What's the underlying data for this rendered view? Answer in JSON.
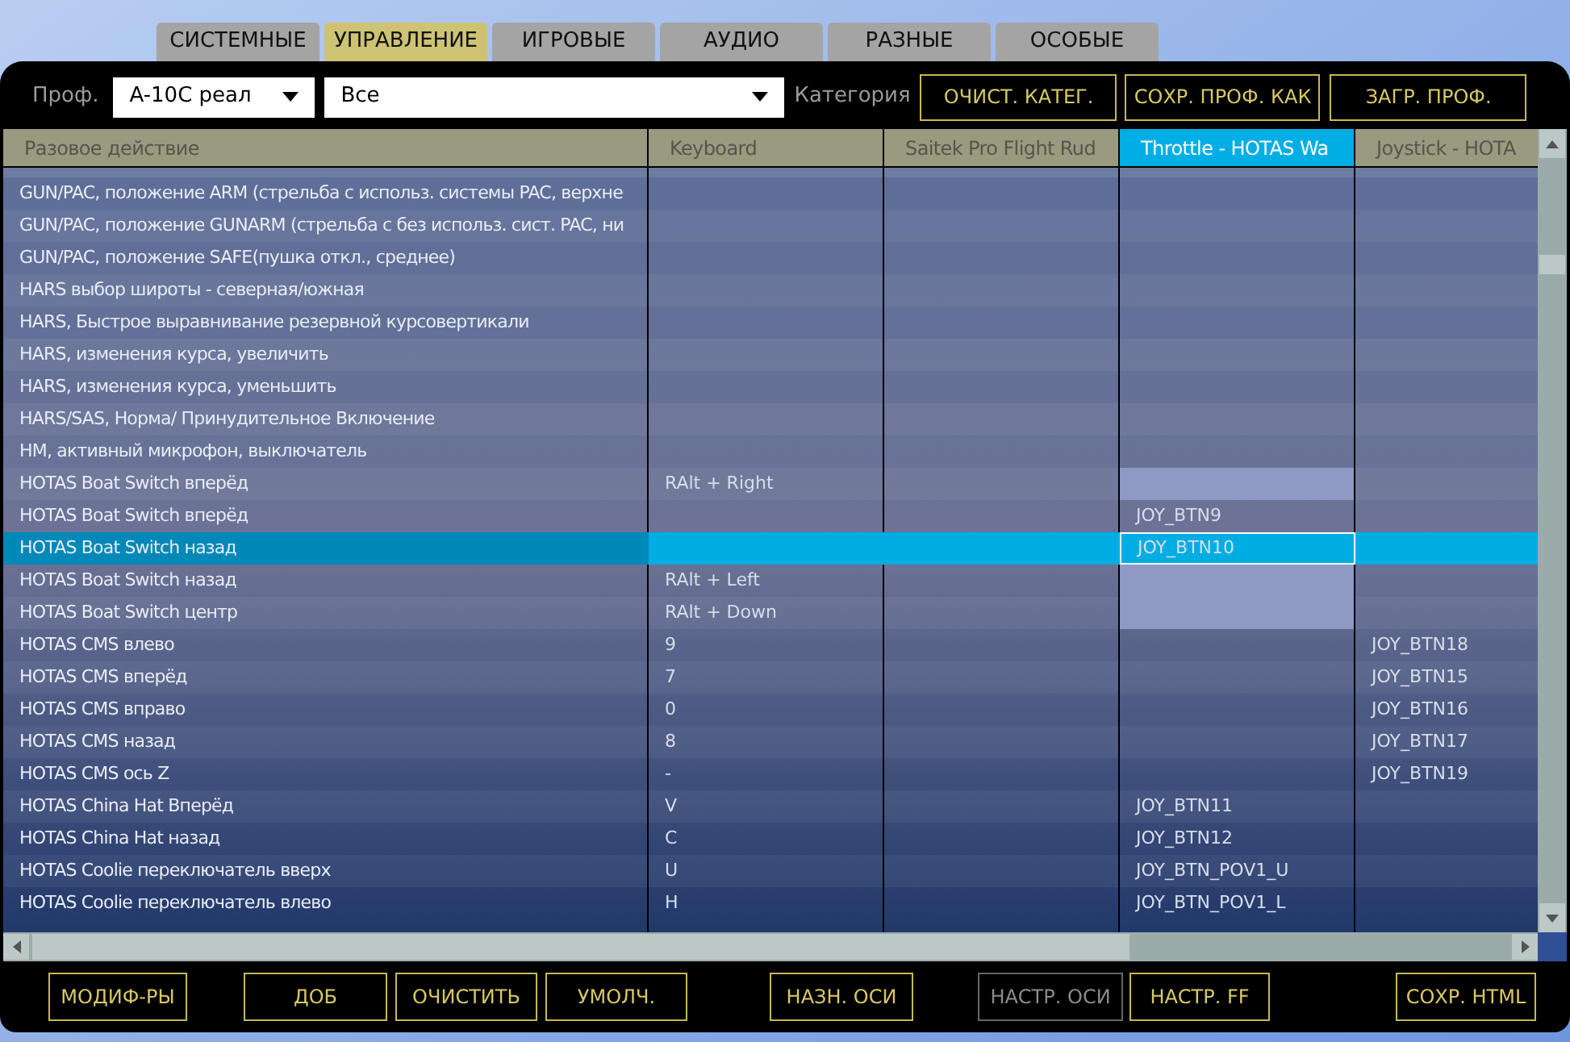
{
  "tabs": [
    {
      "label": "СИСТЕМНЫЕ",
      "selected": false
    },
    {
      "label": "УПРАВЛЕНИЕ",
      "selected": true
    },
    {
      "label": "ИГРОВЫЕ",
      "selected": false
    },
    {
      "label": "АУДИО",
      "selected": false
    },
    {
      "label": "РАЗНЫЕ",
      "selected": false
    },
    {
      "label": "ОСОБЫЕ",
      "selected": false
    }
  ],
  "toolbar": {
    "profile_label": "Проф.",
    "profile": "A-10C реал",
    "filter": "Все",
    "category_label": "Категория",
    "buttons": [
      "ОЧИСТ. КАТЕГ.",
      "СОХР. ПРОФ. КАК",
      "ЗАГР. ПРОФ."
    ]
  },
  "table": {
    "columns": [
      {
        "label": "Разовое действие",
        "selected": false
      },
      {
        "label": "Keyboard",
        "selected": false
      },
      {
        "label": "Saitek Pro Flight Rud",
        "selected": false
      },
      {
        "label": "Throttle - HOTAS Wa",
        "selected": true
      },
      {
        "label": "Joystick - HOTA",
        "selected": false
      }
    ],
    "rows": [
      {
        "cells": [
          "GUN/PAC, положение ARM (стрельба с использ. системы PAC, верхне",
          null,
          null,
          null,
          null
        ],
        "selected": false,
        "marked": false
      },
      {
        "cells": [
          "GUN/PAC, положение GUNARM (стрельба с без использ. сист. PAC, ни",
          null,
          null,
          null,
          null
        ],
        "selected": false,
        "marked": false
      },
      {
        "cells": [
          "GUN/PAC, положение SAFE(пушка откл., среднее)",
          null,
          null,
          null,
          null
        ],
        "selected": false,
        "marked": false
      },
      {
        "cells": [
          "HARS выбор широты - северная/южная",
          null,
          null,
          null,
          null
        ],
        "selected": false,
        "marked": false
      },
      {
        "cells": [
          "HARS, Быстрое выравнивание резервной курсовертикали",
          null,
          null,
          null,
          null
        ],
        "selected": false,
        "marked": false
      },
      {
        "cells": [
          "HARS, изменения курса, увеличить",
          null,
          null,
          null,
          null
        ],
        "selected": false,
        "marked": false
      },
      {
        "cells": [
          "HARS, изменения курса, уменьшить",
          null,
          null,
          null,
          null
        ],
        "selected": false,
        "marked": false
      },
      {
        "cells": [
          "HARS/SAS, Норма/ Принудительное Включение",
          null,
          null,
          null,
          null
        ],
        "selected": false,
        "marked": false
      },
      {
        "cells": [
          "HM, активный микрофон, выключатель",
          null,
          null,
          null,
          null
        ],
        "selected": false,
        "marked": false
      },
      {
        "cells": [
          "HOTAS Boat Switch вперёд",
          "RAlt + Right",
          null,
          null,
          null
        ],
        "selected": false,
        "marked": true
      },
      {
        "cells": [
          "HOTAS Boat Switch вперёд",
          null,
          null,
          "JOY_BTN9",
          null
        ],
        "selected": false,
        "marked": false
      },
      {
        "cells": [
          "HOTAS Boat Switch назад",
          null,
          null,
          "JOY_BTN10",
          null
        ],
        "selected": true,
        "marked": false
      },
      {
        "cells": [
          "HOTAS Boat Switch назад",
          "RAlt + Left",
          null,
          null,
          null
        ],
        "selected": false,
        "marked": true
      },
      {
        "cells": [
          "HOTAS Boat Switch центр",
          "RAlt + Down",
          null,
          null,
          null
        ],
        "selected": false,
        "marked": true
      },
      {
        "cells": [
          "HOTAS CMS влево",
          "9",
          null,
          null,
          "JOY_BTN18"
        ],
        "selected": false,
        "marked": false
      },
      {
        "cells": [
          "HOTAS CMS вперёд",
          "7",
          null,
          null,
          "JOY_BTN15"
        ],
        "selected": false,
        "marked": false
      },
      {
        "cells": [
          "HOTAS CMS вправо",
          "0",
          null,
          null,
          "JOY_BTN16"
        ],
        "selected": false,
        "marked": false
      },
      {
        "cells": [
          "HOTAS CMS назад",
          "8",
          null,
          null,
          "JOY_BTN17"
        ],
        "selected": false,
        "marked": false
      },
      {
        "cells": [
          "HOTAS CMS ось Z",
          "-",
          null,
          null,
          "JOY_BTN19"
        ],
        "selected": false,
        "marked": false
      },
      {
        "cells": [
          "HOTAS China Hat Вперёд",
          "V",
          null,
          "JOY_BTN11",
          null
        ],
        "selected": false,
        "marked": false
      },
      {
        "cells": [
          "HOTAS China Hat назад",
          "C",
          null,
          "JOY_BTN12",
          null
        ],
        "selected": false,
        "marked": false
      },
      {
        "cells": [
          "HOTAS Coolie переключатель вверх",
          "U",
          null,
          "JOY_BTN_POV1_U",
          null
        ],
        "selected": false,
        "marked": false
      },
      {
        "cells": [
          "HOTAS Coolie переключатель влево",
          "H",
          null,
          "JOY_BTN_POV1_L",
          null
        ],
        "selected": false,
        "marked": false
      }
    ]
  },
  "buttons": [
    {
      "label": "МОДИФ-РЫ",
      "disabled": false
    },
    {
      "label": "ДОБ",
      "disabled": false
    },
    {
      "label": "ОЧИСТИТЬ",
      "disabled": false
    },
    {
      "label": "УМОЛЧ.",
      "disabled": false
    },
    {
      "label": "НАЗН. ОСИ",
      "disabled": false
    },
    {
      "label": "НАСТР. ОСИ",
      "disabled": true
    },
    {
      "label": "НАСТР. FF",
      "disabled": false
    },
    {
      "label": "СОХР. HTML",
      "disabled": false
    }
  ]
}
